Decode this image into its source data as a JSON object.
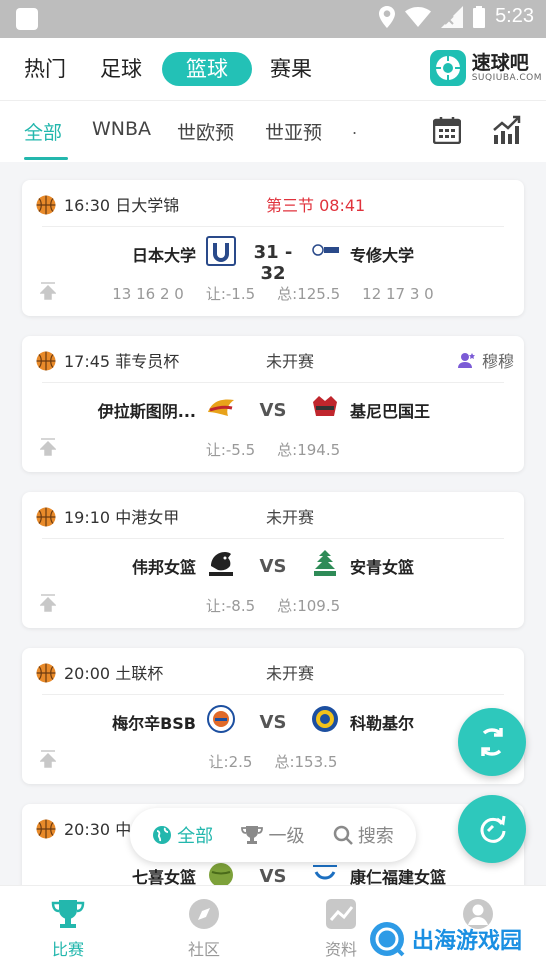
{
  "status_bar": {
    "time": "5:23"
  },
  "top_tabs": [
    {
      "label": "热门"
    },
    {
      "label": "足球"
    },
    {
      "label": "篮球"
    },
    {
      "label": "赛果"
    }
  ],
  "brand": {
    "name": "速球吧",
    "domain": "SUQIUBA.COM"
  },
  "sub_tabs": [
    {
      "label": "全部"
    },
    {
      "label": "WNBA"
    },
    {
      "label": "世欧预"
    },
    {
      "label": "世亚预"
    },
    {
      "label": "."
    }
  ],
  "matches": [
    {
      "time_league": "16:30 日大学锦",
      "status": "第三节  08:41",
      "home": "日本大学",
      "away": "专修大学",
      "score": "31 - 32",
      "line": [
        "13  16  2  0",
        "让:-1.5",
        "总:125.5",
        "12  17  3  0"
      ]
    },
    {
      "time_league": "17:45 菲专员杯",
      "status": "未开赛",
      "extra": "穆穆",
      "home": "伊拉斯图阴...",
      "away": "基尼巴国王",
      "vs": "VS",
      "line": [
        "让:-5.5",
        "总:194.5"
      ]
    },
    {
      "time_league": "19:10 中港女甲",
      "status": "未开赛",
      "home": "伟邦女篮",
      "away": "安青女篮",
      "vs": "VS",
      "line": [
        "让:-8.5",
        "总:109.5"
      ]
    },
    {
      "time_league": "20:00 土联杯",
      "status": "未开赛",
      "home": "梅尔辛BSB",
      "away": "科勒基尔",
      "vs": "VS",
      "line": [
        "让:2.5",
        "总:153.5"
      ]
    },
    {
      "time_league": "20:30 中",
      "home": "七喜女篮",
      "away": "康仁福建女篮",
      "vs": "VS"
    }
  ],
  "filter": [
    {
      "label": "全部"
    },
    {
      "label": "一级"
    },
    {
      "label": "搜索"
    }
  ],
  "bottom_nav": [
    {
      "label": "比赛"
    },
    {
      "label": "社区"
    },
    {
      "label": "资料"
    },
    {
      "label": ""
    }
  ],
  "watermark": {
    "text": "出海游戏园"
  },
  "colors": {
    "accent": "#23c1b6",
    "live": "#e0323c",
    "ball": "#e88a2a"
  }
}
